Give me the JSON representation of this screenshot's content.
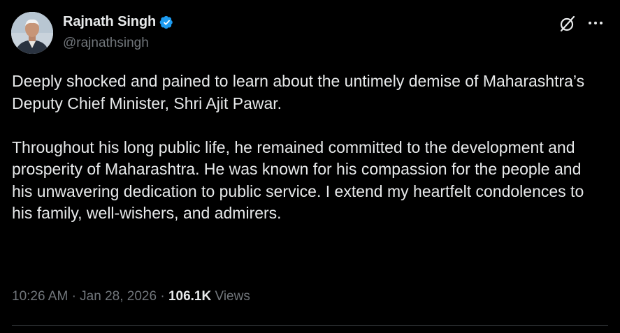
{
  "author": {
    "display_name": "Rajnath Singh",
    "handle": "@rajnathsingh",
    "verified": true,
    "verified_color": "#1d9bf0"
  },
  "tweet": {
    "paragraphs": [
      "Deeply shocked and pained to learn about the untimely demise of Maharashtra’s Deputy Chief Minister, Shri Ajit Pawar.",
      "Throughout his long public life, he remained committed to the development and prosperity of Maharashtra. He was known for his compassion for the people and his unwavering dedication to public service. I extend my heartfelt condolences to his family, well-wishers, and admirers."
    ]
  },
  "meta": {
    "time": "10:26 AM",
    "separator": "·",
    "date": "Jan 28, 2026",
    "views_count": "106.1K",
    "views_label": "Views"
  },
  "icons": {
    "grok": "grok-icon",
    "more": "more-icon",
    "verified": "verified-badge-icon"
  },
  "colors": {
    "background": "#000000",
    "text": "#e7e9ea",
    "secondary_text": "#71767b",
    "divider": "#2f3336"
  }
}
